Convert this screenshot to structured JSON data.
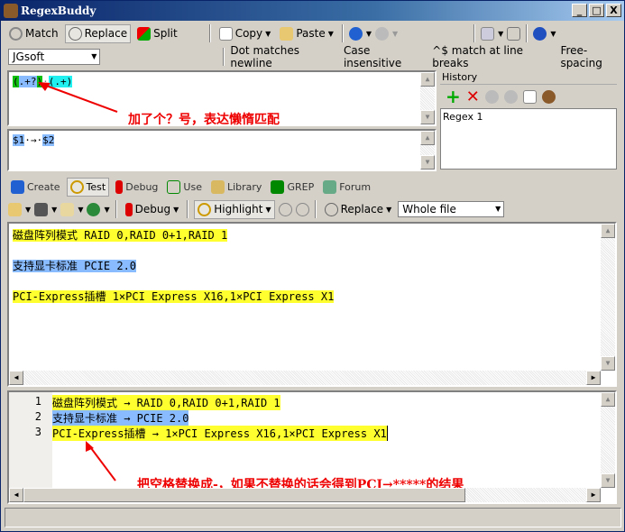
{
  "window": {
    "title": "RegexBuddy",
    "controls": [
      "_",
      "□",
      "X"
    ]
  },
  "toolbar1": {
    "match": "Match",
    "replace": "Replace",
    "split": "Split",
    "copy": "Copy",
    "paste": "Paste"
  },
  "toolbar2": {
    "flavor": "JGsoft",
    "options": [
      "Dot matches newline",
      "Case insensitive",
      "^$ match at line breaks",
      "Free-spacing"
    ]
  },
  "regex": {
    "parts": [
      "(",
      ".+?",
      ")",
      "·",
      "(.+)"
    ]
  },
  "replacement": {
    "parts": [
      "$1",
      "·→·",
      "$2"
    ]
  },
  "annotations": {
    "regex_note": "加了个？号，表达懒惰匹配",
    "result_note": "把空格替换成-，如果不替换的话会得到PCI→*****的结果"
  },
  "history": {
    "title": "History",
    "items": [
      "Regex 1"
    ]
  },
  "tabs": [
    "Create",
    "Test",
    "Debug",
    "Use",
    "Library",
    "GREP",
    "Forum"
  ],
  "test_toolbar": {
    "debug": "Debug",
    "highlight": "Highlight",
    "replace": "Replace",
    "scope": "Whole file"
  },
  "test_text": [
    "磁盘阵列模式 RAID 0,RAID 0+1,RAID 1",
    "支持显卡标准 PCIE 2.0",
    "PCI-Express插槽 1×PCI Express X16,1×PCI Express X1"
  ],
  "results": [
    {
      "num": "1",
      "text": "磁盘阵列模式 → RAID 0,RAID 0+1,RAID 1"
    },
    {
      "num": "2",
      "text": "支持显卡标准 → PCIE 2.0"
    },
    {
      "num": "3",
      "text": "PCI-Express插槽 → 1×PCI Express X16,1×PCI Express X1"
    }
  ]
}
